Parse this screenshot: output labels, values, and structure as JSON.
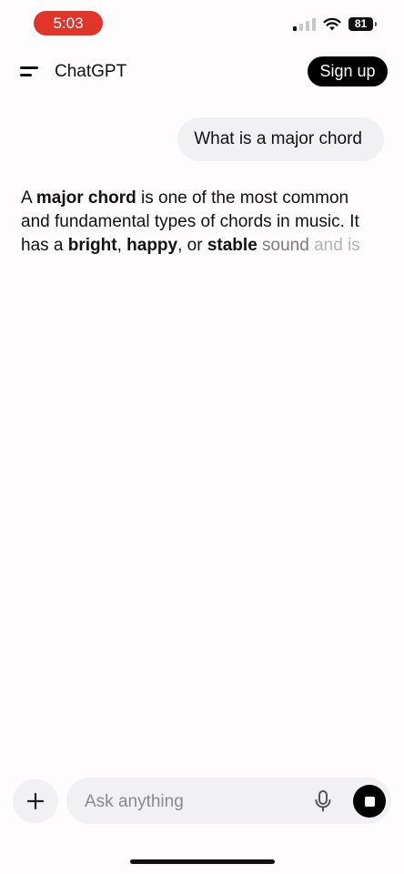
{
  "status_bar": {
    "time": "5:03",
    "battery": "81",
    "signal_icon": "cellular-signal-icon",
    "wifi_icon": "wifi-icon",
    "battery_icon": "battery-icon",
    "time_pill_color": "#e0352b"
  },
  "header": {
    "menu_icon": "menu-icon",
    "title": "ChatGPT",
    "signup_label": "Sign up"
  },
  "conversation": {
    "user_message": "What is a major chord",
    "assistant_message": {
      "t1": "A ",
      "b1": "major chord",
      "t2": " is one of the most common and fundamental types of chords in music. It has a ",
      "b2": "bright",
      "t3": ", ",
      "b3": "happy",
      "t4": ", or ",
      "b4": "stable",
      "t5": " sound",
      "t6": " and is"
    }
  },
  "composer": {
    "placeholder": "Ask anything",
    "plus_icon": "plus-icon",
    "mic_icon": "microphone-icon",
    "stop_icon": "stop-icon"
  }
}
